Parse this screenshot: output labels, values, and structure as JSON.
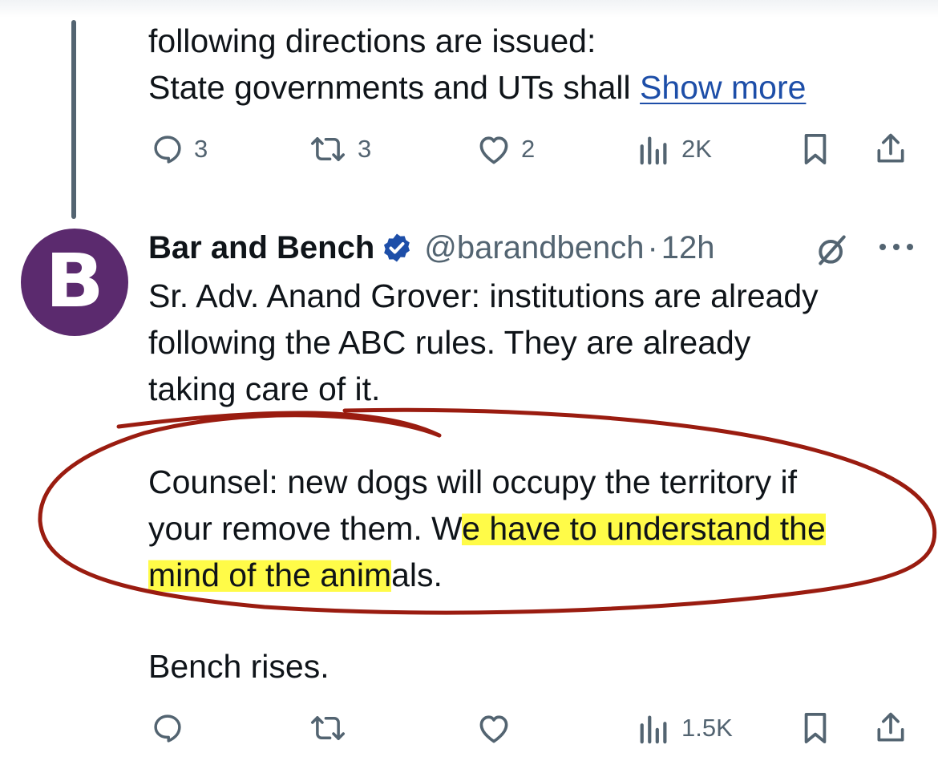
{
  "previous_tweet": {
    "line1": "following directions are issued:",
    "line2": "State governments and UTs shall ",
    "show_more": "Show more",
    "actions": {
      "replies": "3",
      "retweets": "3",
      "likes": "2",
      "views": "2K"
    }
  },
  "tweet": {
    "avatar_letter": "B",
    "avatar_color": "#5b2a6e",
    "author_name": "Bar and Bench",
    "verified": true,
    "handle": "@barandbench",
    "separator": "·",
    "time": "12h",
    "body_lines": [
      "Sr. Adv. Anand Grover: institutions are already",
      "following the ABC rules. They are already",
      "taking care of it."
    ],
    "counsel_line1": "Counsel: new dogs will occupy the territory if",
    "counsel_line2_plain": "your remove them. W",
    "counsel_line2_highlight": "e have to understand the",
    "counsel_line3_highlight": "mind of the anim",
    "counsel_line3_plain": "als.",
    "closing_line": "Bench rises.",
    "actions": {
      "views": "1.5K"
    }
  },
  "colors": {
    "muted": "#536471",
    "link": "#1d4ea8",
    "verified_badge": "#1d9bf0",
    "highlight": "#fff928",
    "annotation_ink": "#9a1c10"
  }
}
